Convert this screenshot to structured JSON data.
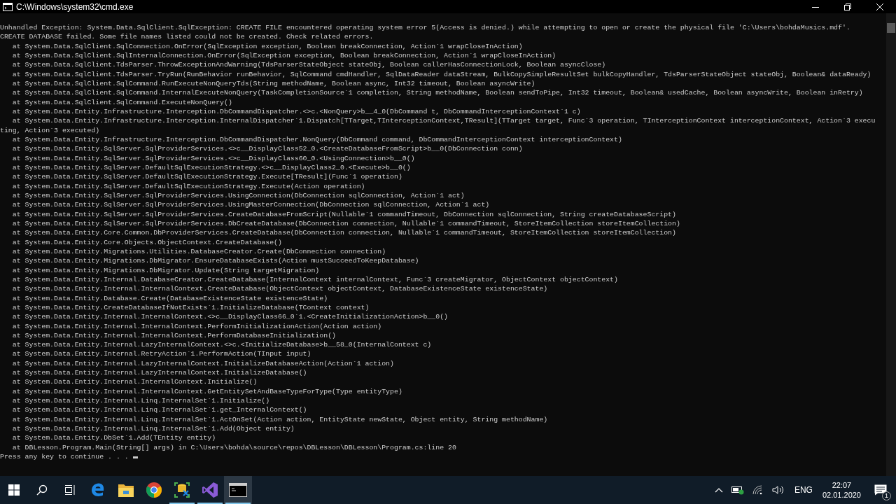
{
  "window": {
    "title": "C:\\Windows\\system32\\cmd.exe"
  },
  "console_lines": [
    "Unhandled Exception: System.Data.SqlClient.SqlException: CREATE FILE encountered operating system error 5(Access is denied.) while attempting to open or create the physical file 'C:\\Users\\bohdaMusics.mdf'.",
    "CREATE DATABASE failed. Some file names listed could not be created. Check related errors.",
    "   at System.Data.SqlClient.SqlConnection.OnError(SqlException exception, Boolean breakConnection, Action`1 wrapCloseInAction)",
    "   at System.Data.SqlClient.SqlInternalConnection.OnError(SqlException exception, Boolean breakConnection, Action`1 wrapCloseInAction)",
    "   at System.Data.SqlClient.TdsParser.ThrowExceptionAndWarning(TdsParserStateObject stateObj, Boolean callerHasConnectionLock, Boolean asyncClose)",
    "   at System.Data.SqlClient.TdsParser.TryRun(RunBehavior runBehavior, SqlCommand cmdHandler, SqlDataReader dataStream, BulkCopySimpleResultSet bulkCopyHandler, TdsParserStateObject stateObj, Boolean& dataReady)",
    "   at System.Data.SqlClient.SqlCommand.RunExecuteNonQueryTds(String methodName, Boolean async, Int32 timeout, Boolean asyncWrite)",
    "   at System.Data.SqlClient.SqlCommand.InternalExecuteNonQuery(TaskCompletionSource`1 completion, String methodName, Boolean sendToPipe, Int32 timeout, Boolean& usedCache, Boolean asyncWrite, Boolean inRetry)",
    "   at System.Data.SqlClient.SqlCommand.ExecuteNonQuery()",
    "   at System.Data.Entity.Infrastructure.Interception.DbCommandDispatcher.<>c.<NonQuery>b__4_0(DbCommand t, DbCommandInterceptionContext`1 c)",
    "   at System.Data.Entity.Infrastructure.Interception.InternalDispatcher`1.Dispatch[TTarget,TInterceptionContext,TResult](TTarget target, Func`3 operation, TInterceptionContext interceptionContext, Action`3 execu",
    "ting, Action`3 executed)",
    "   at System.Data.Entity.Infrastructure.Interception.DbCommandDispatcher.NonQuery(DbCommand command, DbCommandInterceptionContext interceptionContext)",
    "   at System.Data.Entity.SqlServer.SqlProviderServices.<>c__DisplayClass52_0.<CreateDatabaseFromScript>b__0(DbConnection conn)",
    "   at System.Data.Entity.SqlServer.SqlProviderServices.<>c__DisplayClass60_0.<UsingConnection>b__0()",
    "   at System.Data.Entity.SqlServer.DefaultSqlExecutionStrategy.<>c__DisplayClass2_0.<Execute>b__0()",
    "   at System.Data.Entity.SqlServer.DefaultSqlExecutionStrategy.Execute[TResult](Func`1 operation)",
    "   at System.Data.Entity.SqlServer.DefaultSqlExecutionStrategy.Execute(Action operation)",
    "   at System.Data.Entity.SqlServer.SqlProviderServices.UsingConnection(DbConnection sqlConnection, Action`1 act)",
    "   at System.Data.Entity.SqlServer.SqlProviderServices.UsingMasterConnection(DbConnection sqlConnection, Action`1 act)",
    "   at System.Data.Entity.SqlServer.SqlProviderServices.CreateDatabaseFromScript(Nullable`1 commandTimeout, DbConnection sqlConnection, String createDatabaseScript)",
    "   at System.Data.Entity.SqlServer.SqlProviderServices.DbCreateDatabase(DbConnection connection, Nullable`1 commandTimeout, StoreItemCollection storeItemCollection)",
    "   at System.Data.Entity.Core.Common.DbProviderServices.CreateDatabase(DbConnection connection, Nullable`1 commandTimeout, StoreItemCollection storeItemCollection)",
    "   at System.Data.Entity.Core.Objects.ObjectContext.CreateDatabase()",
    "   at System.Data.Entity.Migrations.Utilities.DatabaseCreator.Create(DbConnection connection)",
    "   at System.Data.Entity.Migrations.DbMigrator.EnsureDatabaseExists(Action mustSucceedToKeepDatabase)",
    "   at System.Data.Entity.Migrations.DbMigrator.Update(String targetMigration)",
    "   at System.Data.Entity.Internal.DatabaseCreator.CreateDatabase(InternalContext internalContext, Func`3 createMigrator, ObjectContext objectContext)",
    "   at System.Data.Entity.Internal.InternalContext.CreateDatabase(ObjectContext objectContext, DatabaseExistenceState existenceState)",
    "   at System.Data.Entity.Database.Create(DatabaseExistenceState existenceState)",
    "   at System.Data.Entity.CreateDatabaseIfNotExists`1.InitializeDatabase(TContext context)",
    "   at System.Data.Entity.Internal.InternalContext.<>c__DisplayClass66_0`1.<CreateInitializationAction>b__0()",
    "   at System.Data.Entity.Internal.InternalContext.PerformInitializationAction(Action action)",
    "   at System.Data.Entity.Internal.InternalContext.PerformDatabaseInitialization()",
    "   at System.Data.Entity.Internal.LazyInternalContext.<>c.<InitializeDatabase>b__58_0(InternalContext c)",
    "   at System.Data.Entity.Internal.RetryAction`1.PerformAction(TInput input)",
    "   at System.Data.Entity.Internal.LazyInternalContext.InitializeDatabaseAction(Action`1 action)",
    "   at System.Data.Entity.Internal.LazyInternalContext.InitializeDatabase()",
    "   at System.Data.Entity.Internal.InternalContext.Initialize()",
    "   at System.Data.Entity.Internal.InternalContext.GetEntitySetAndBaseTypeForType(Type entityType)",
    "   at System.Data.Entity.Internal.Linq.InternalSet`1.Initialize()",
    "   at System.Data.Entity.Internal.Linq.InternalSet`1.get_InternalContext()",
    "   at System.Data.Entity.Internal.Linq.InternalSet`1.ActOnSet(Action action, EntityState newState, Object entity, String methodName)",
    "   at System.Data.Entity.Internal.Linq.InternalSet`1.Add(Object entity)",
    "   at System.Data.Entity.DbSet`1.Add(TEntity entity)",
    "   at DBLesson.Program.Main(String[] args) in C:\\Users\\bohda\\source\\repos\\DBLesson\\DBLesson\\Program.cs:line 20",
    "Press any key to continue . . . "
  ],
  "taskbar": {
    "apps": [
      {
        "kind": "edge",
        "running": false,
        "selected": false
      },
      {
        "kind": "explorer",
        "running": false,
        "selected": false
      },
      {
        "kind": "chrome",
        "running": false,
        "selected": false
      },
      {
        "kind": "yellow",
        "running": true,
        "selected": false
      },
      {
        "kind": "vs",
        "running": true,
        "selected": false
      },
      {
        "kind": "cmd",
        "running": true,
        "selected": true
      }
    ],
    "language": "ENG",
    "time": "22:07",
    "date": "02.01.2020",
    "notification_count": "1"
  }
}
